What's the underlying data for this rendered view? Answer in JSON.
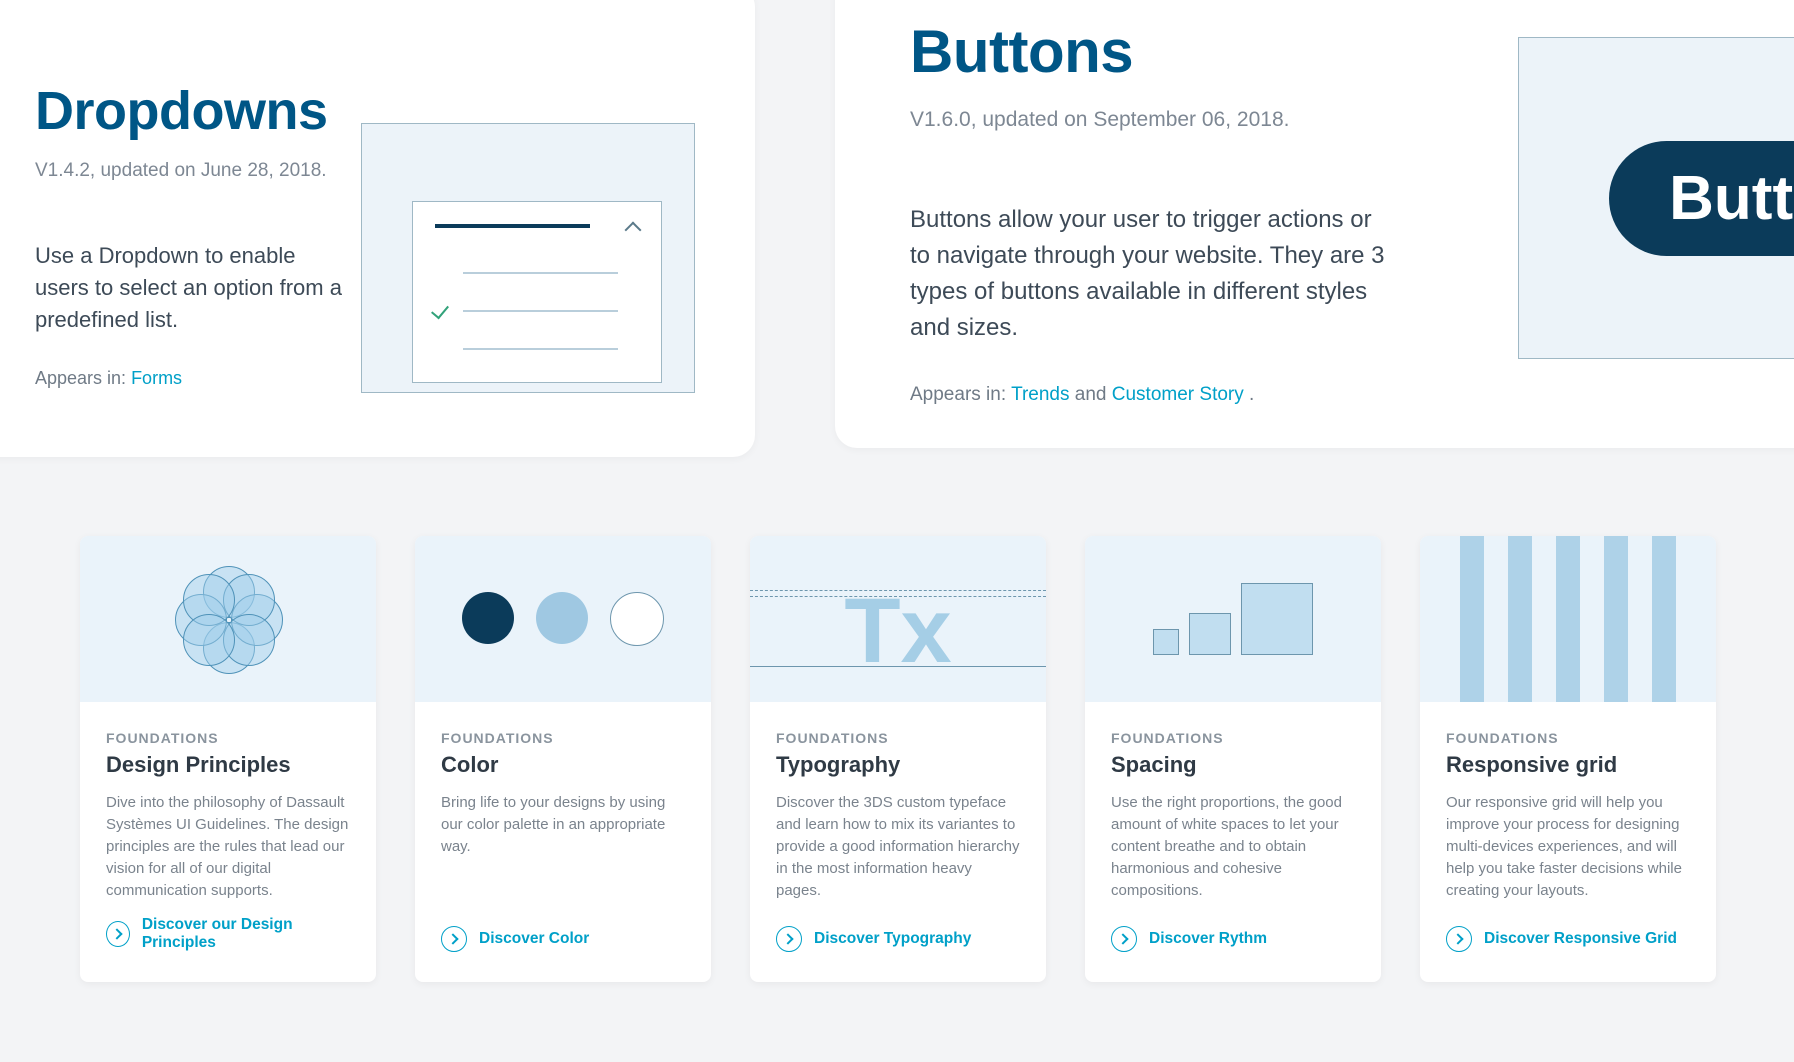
{
  "dropdowns_card": {
    "title": "Dropdowns",
    "meta": "V1.4.2, updated on June 28, 2018.",
    "description": "Use a Dropdown to enable users to select an option from a predefined list.",
    "appears_prefix": "Appears in: ",
    "appears_link": "Forms"
  },
  "buttons_card": {
    "title": "Buttons",
    "meta": "V1.6.0, updated on September 06, 2018.",
    "description": "Buttons allow your user to trigger actions or to navigate through your website. They are 3 types of buttons available in different styles and sizes.",
    "appears_prefix": "Appears in: ",
    "appears_link_1": "Trends",
    "appears_mid": " and ",
    "appears_link_2": "Customer Story",
    "appears_suffix": ".",
    "pill_label": "Button"
  },
  "foundation_kicker": "FOUNDATIONS",
  "cards": [
    {
      "title": "Design Principles",
      "text": "Dive into the philosophy of Dassault Systèmes UI Guidelines. The design principles are the rules that lead our vision for all of our digital communication supports.",
      "cta": "Discover our Design Principles"
    },
    {
      "title": "Color",
      "text": "Bring life to your designs by using our color palette in an appropriate way.",
      "cta": "Discover Color"
    },
    {
      "title": "Typography",
      "text": "Discover the 3DS custom typeface and learn how to mix its variantes to provide a good information hierarchy in the most information heavy pages.",
      "cta": "Discover Typography"
    },
    {
      "title": "Spacing",
      "text": "Use the right proportions, the good amount of white spaces to let your content breathe and to obtain harmonious and cohesive compositions.",
      "cta": "Discover Rythm"
    },
    {
      "title": "Responsive grid",
      "text": "Our responsive grid will help you improve your process for designing multi-devices experiences, and will help you take faster decisions while creating your layouts.",
      "cta": "Discover Responsive Grid"
    }
  ]
}
